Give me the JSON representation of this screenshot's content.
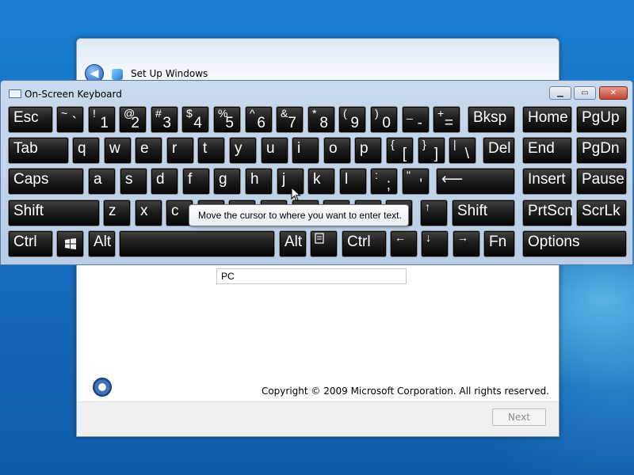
{
  "setup": {
    "title": "Set Up Windows",
    "computer_name_value": "PC",
    "copyright": "Copyright © 2009 Microsoft Corporation.  All rights reserved.",
    "next_label": "Next"
  },
  "osk": {
    "title": "On-Screen Keyboard",
    "tooltip": "Move the cursor to where you want to enter text."
  },
  "keys": {
    "esc": "Esc",
    "bksp": "Bksp",
    "home": "Home",
    "pgup": "PgUp",
    "tab": "Tab",
    "del": "Del",
    "end": "End",
    "pgdn": "PgDn",
    "caps": "Caps",
    "insert": "Insert",
    "pause": "Pause",
    "shift": "Shift",
    "prtscn": "PrtScn",
    "scrlk": "ScrLk",
    "ctrl": "Ctrl",
    "alt": "Alt",
    "fn": "Fn",
    "options": "Options",
    "number_row": [
      {
        "top": "~",
        "bot": "`"
      },
      {
        "top": "!",
        "bot": "1"
      },
      {
        "top": "@",
        "bot": "2"
      },
      {
        "top": "#",
        "bot": "3"
      },
      {
        "top": "$",
        "bot": "4"
      },
      {
        "top": "%",
        "bot": "5"
      },
      {
        "top": "^",
        "bot": "6"
      },
      {
        "top": "&",
        "bot": "7"
      },
      {
        "top": "*",
        "bot": "8"
      },
      {
        "top": "(",
        "bot": "9"
      },
      {
        "top": ")",
        "bot": "0"
      },
      {
        "top": "_",
        "bot": "-"
      },
      {
        "top": "+",
        "bot": "="
      }
    ],
    "q_row": [
      "q",
      "w",
      "e",
      "r",
      "t",
      "y",
      "u",
      "i",
      "o",
      "p"
    ],
    "q_row_sym": [
      {
        "top": "{",
        "bot": "["
      },
      {
        "top": "}",
        "bot": "]"
      },
      {
        "top": "|",
        "bot": "\\"
      }
    ],
    "a_row": [
      "a",
      "s",
      "d",
      "f",
      "g",
      "h",
      "j",
      "k",
      "l"
    ],
    "a_row_sym": [
      {
        "top": ":",
        "bot": ";"
      },
      {
        "top": "\"",
        "bot": "'"
      }
    ],
    "z_row": [
      "z",
      "x",
      "c"
    ],
    "arrows": {
      "up": "↑",
      "down": "↓",
      "left": "←",
      "right": "→",
      "enter": "⟵"
    }
  },
  "icons": {
    "back": "back-arrow-icon",
    "windows": "windows-logo-icon",
    "menu": "menu-key-icon",
    "access": "ease-of-access-icon"
  },
  "colors": {
    "desktop": "#1670c2",
    "key_face": "#1d1d1d",
    "osk_frame": "#c9daee",
    "close": "#c24530"
  }
}
